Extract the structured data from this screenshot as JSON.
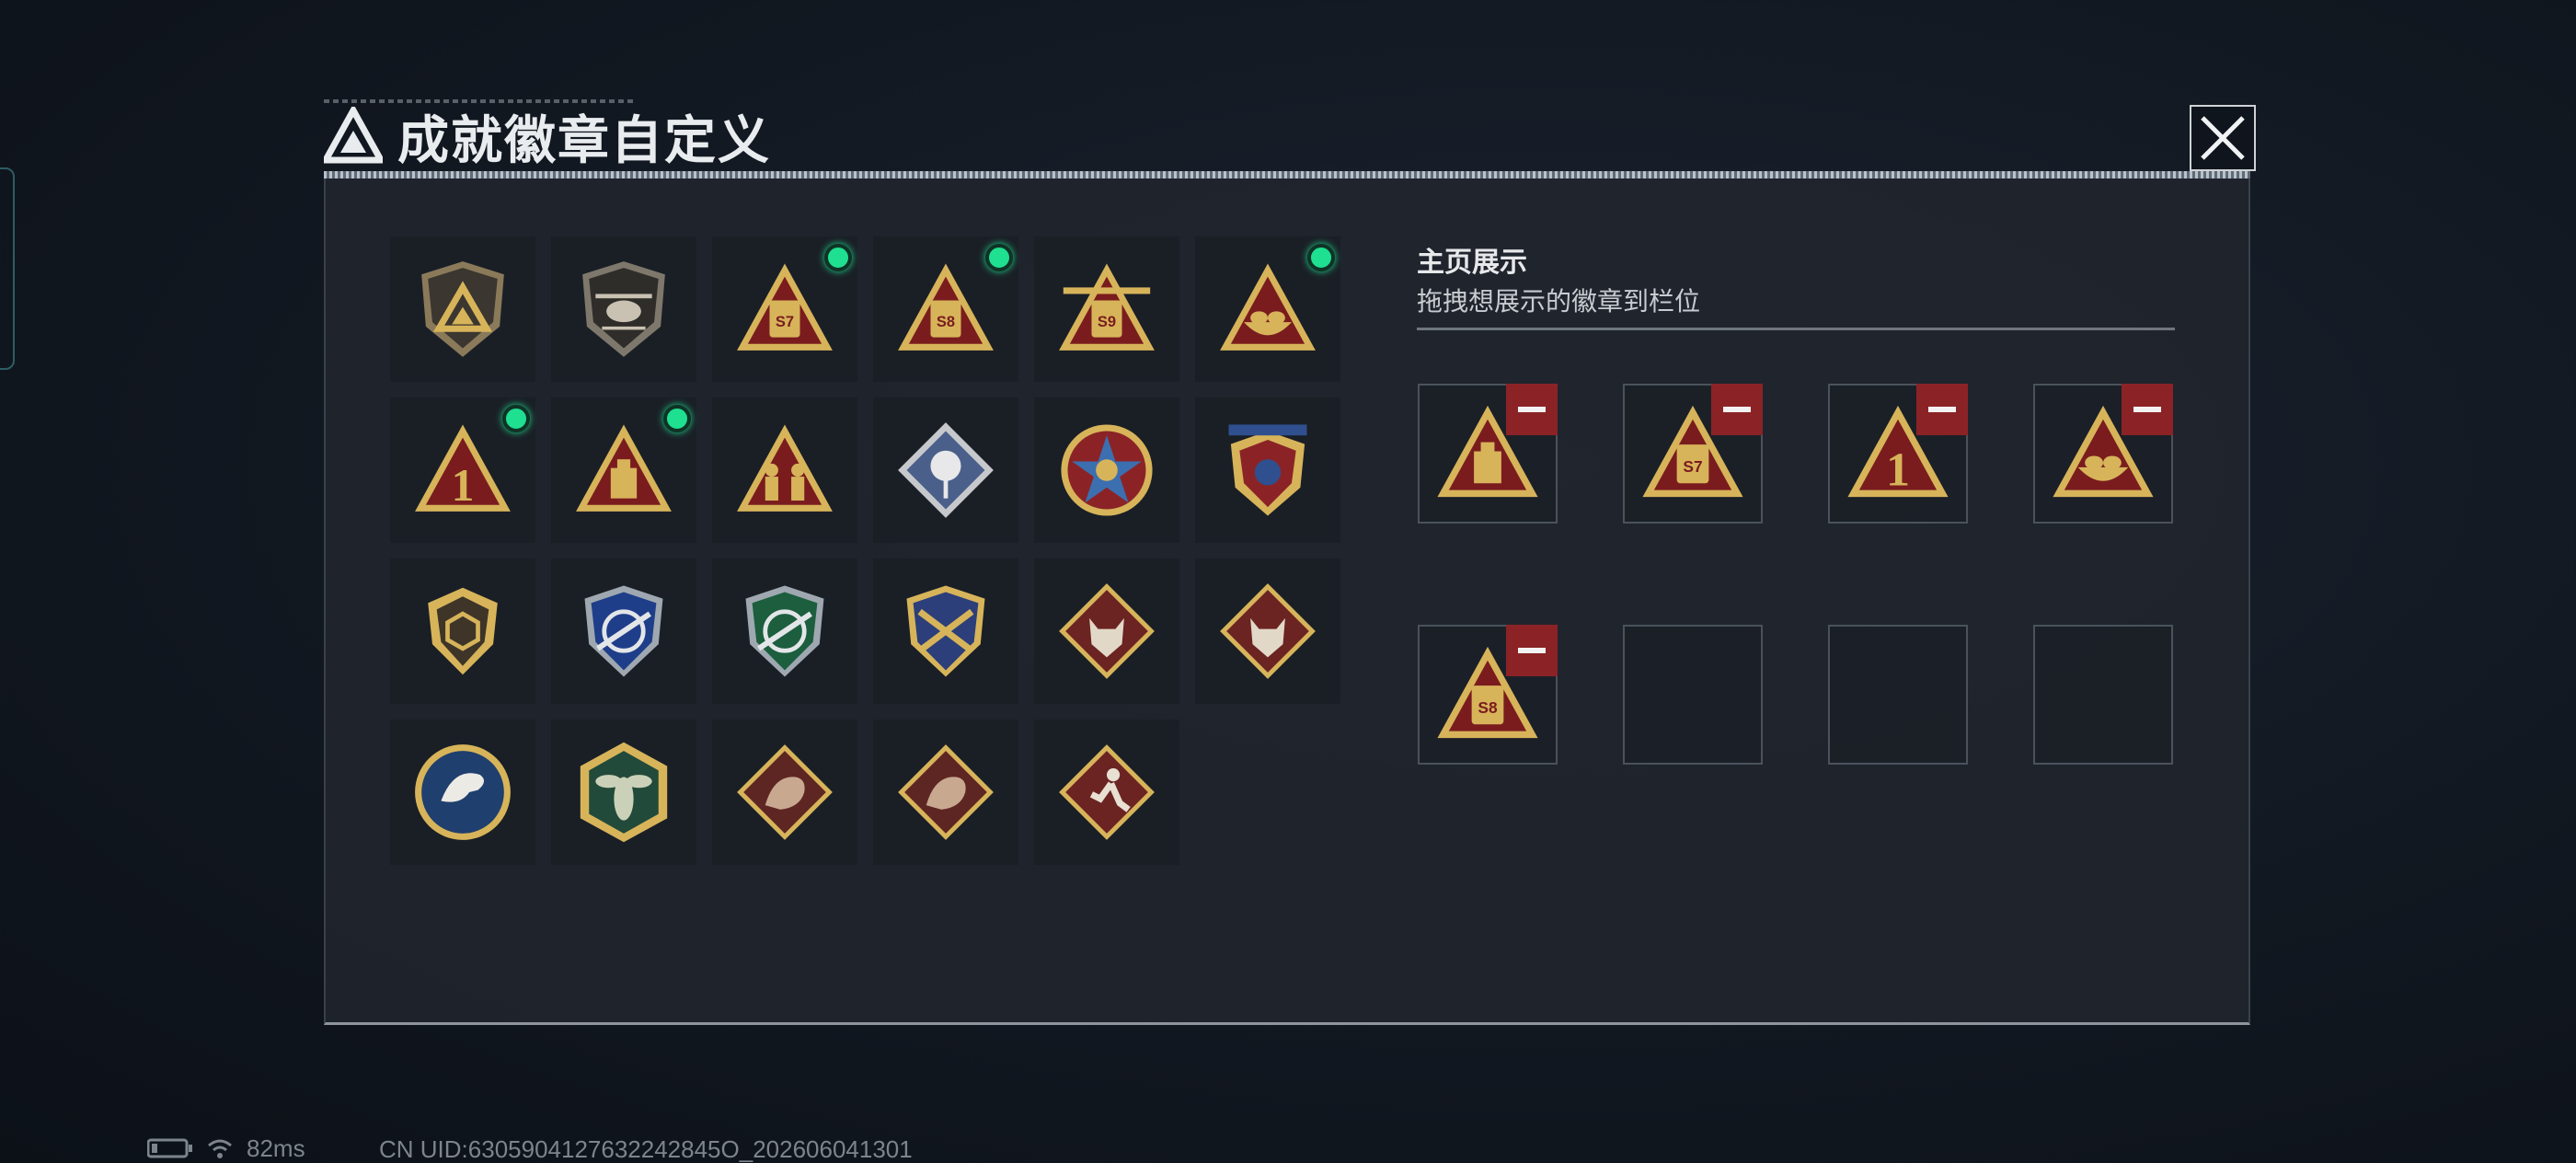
{
  "modal": {
    "title": "成就徽章自定义"
  },
  "badge_grid": {
    "items": [
      {
        "icon": "shield-triangle-logo-badge-icon",
        "equipped": false
      },
      {
        "icon": "helicopter-shield-badge-icon",
        "equipped": false
      },
      {
        "icon": "triangle-s7-badge-icon",
        "label": "S7",
        "equipped": true
      },
      {
        "icon": "triangle-s8-badge-icon",
        "label": "S8",
        "equipped": true
      },
      {
        "icon": "triangle-s9-winged-badge-icon",
        "label": "S9",
        "equipped": false
      },
      {
        "icon": "triangle-nest-badge-icon",
        "equipped": true
      },
      {
        "icon": "triangle-number-one-badge-icon",
        "label": "1",
        "equipped": true
      },
      {
        "icon": "triangle-box-badge-icon",
        "equipped": true
      },
      {
        "icon": "triangle-soldiers-badge-icon",
        "equipped": false
      },
      {
        "icon": "rose-diamond-badge-icon",
        "equipped": false
      },
      {
        "icon": "star-compass-badge-icon",
        "equipped": false
      },
      {
        "icon": "stars-crest-badge-icon",
        "equipped": false
      },
      {
        "icon": "hexagon-shield-badge-icon",
        "equipped": false
      },
      {
        "icon": "blue-crosshair-shield-badge-icon",
        "equipped": false
      },
      {
        "icon": "green-crosshair-shield-badge-icon",
        "equipped": false
      },
      {
        "icon": "gold-crossed-rifles-badge-icon",
        "equipped": false
      },
      {
        "icon": "wolf-diamond-badge-icon",
        "equipped": false
      },
      {
        "icon": "wolf-diamond-badge-icon",
        "equipped": false
      },
      {
        "icon": "eagle-circle-badge-icon",
        "equipped": false
      },
      {
        "icon": "hornet-hexagon-badge-icon",
        "equipped": false
      },
      {
        "icon": "dragon-diamond-badge-icon",
        "equipped": false
      },
      {
        "icon": "dragon-diamond-badge-icon",
        "equipped": false
      },
      {
        "icon": "runner-diamond-badge-icon",
        "equipped": false
      }
    ]
  },
  "display": {
    "title": "主页展示",
    "subtitle": "拖拽想展示的徽章到栏位",
    "slots": [
      {
        "icon": "triangle-box-badge-icon"
      },
      {
        "icon": "triangle-s7-badge-icon",
        "label": "S7"
      },
      {
        "icon": "triangle-number-one-badge-icon",
        "label": "1"
      },
      {
        "icon": "triangle-nest-badge-icon"
      },
      {
        "icon": "triangle-s8-badge-icon",
        "label": "S8"
      },
      {
        "icon": null
      },
      {
        "icon": null
      },
      {
        "icon": null
      }
    ]
  },
  "status": {
    "ping": "82ms",
    "uid": "CN UID:6305904127632242845O_202606041301"
  },
  "colors": {
    "accent_red": "#8b2326",
    "equipped_green": "#1fe090",
    "badge_gold": "#d7b45a",
    "badge_red": "#7a1c1e"
  }
}
